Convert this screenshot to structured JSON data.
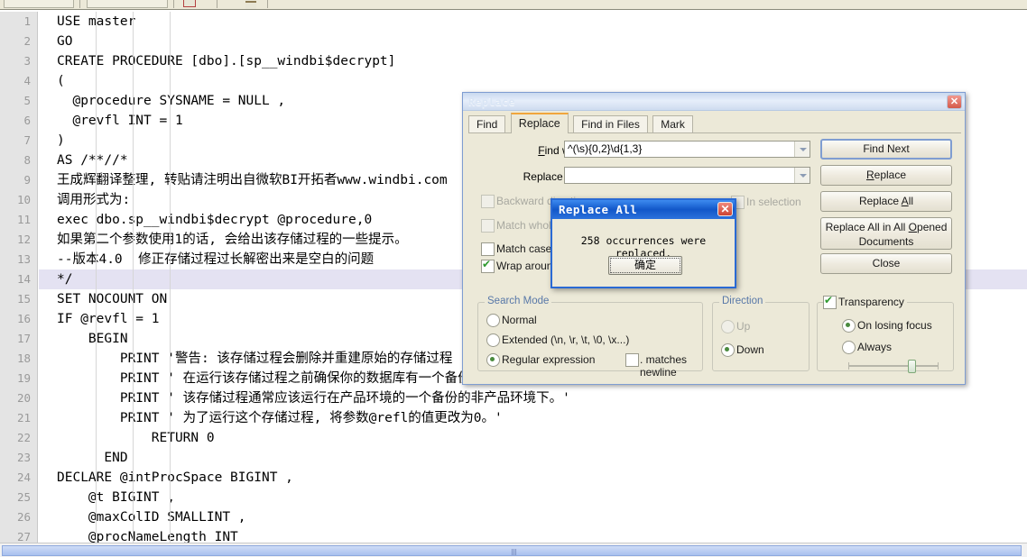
{
  "toolbar": {
    "name": "editor-toolbar"
  },
  "editor": {
    "current_line": 14,
    "lines": [
      {
        "n": "1",
        "text": "USE master"
      },
      {
        "n": "2",
        "text": "GO"
      },
      {
        "n": "3",
        "text": "CREATE PROCEDURE [dbo].[sp__windbi$decrypt]"
      },
      {
        "n": "4",
        "text": "("
      },
      {
        "n": "5",
        "text": "  @procedure SYSNAME = NULL ,"
      },
      {
        "n": "6",
        "text": "  @revfl INT = 1"
      },
      {
        "n": "7",
        "text": ")"
      },
      {
        "n": "8",
        "text": "AS /**//*"
      },
      {
        "n": "9",
        "text": "王成辉翻译整理, 转贴请注明出自微软BI开拓者www.windbi.com"
      },
      {
        "n": "10",
        "text": "调用形式为:"
      },
      {
        "n": "11",
        "text": "exec dbo.sp__windbi$decrypt @procedure,0"
      },
      {
        "n": "12",
        "text": "如果第二个参数使用1的话, 会给出该存储过程的一些提示。"
      },
      {
        "n": "13",
        "text": "--版本4.0  修正存储过程过长解密出来是空白的问题"
      },
      {
        "n": "14",
        "text": "*/"
      },
      {
        "n": "15",
        "text": "SET NOCOUNT ON"
      },
      {
        "n": "16",
        "text": "IF @revfl = 1"
      },
      {
        "n": "17",
        "text": "    BEGIN"
      },
      {
        "n": "18",
        "text": "        PRINT '警告: 该存储过程会删除并重建原始的存储过程"
      },
      {
        "n": "19",
        "text": "        PRINT ' 在运行该存储过程之前确保你的数据库有一个备份。'"
      },
      {
        "n": "20",
        "text": "        PRINT ' 该存储过程通常应该运行在产品环境的一个备份的非产品环境下。'"
      },
      {
        "n": "21",
        "text": "        PRINT ' 为了运行这个存储过程, 将参数@refl的值更改为0。'"
      },
      {
        "n": "22",
        "text": "            RETURN 0"
      },
      {
        "n": "23",
        "text": "      END"
      },
      {
        "n": "24",
        "text": "DECLARE @intProcSpace BIGINT ,"
      },
      {
        "n": "25",
        "text": "    @t BIGINT ,"
      },
      {
        "n": "26",
        "text": "    @maxColID SMALLINT ,"
      },
      {
        "n": "27",
        "text": "    @procNameLength INT"
      }
    ]
  },
  "replace_dialog": {
    "title": "Replace",
    "close_label": "✕",
    "tabs": [
      {
        "label": "Find",
        "active": false
      },
      {
        "label": "Replace",
        "active": true
      },
      {
        "label": "Find in Files",
        "active": false
      },
      {
        "label": "Mark",
        "active": false
      }
    ],
    "find_what_label": "Find what :",
    "find_what_value": "^(\\s){0,2}\\d{1,3}",
    "replace_with_label": "Replace with :",
    "replace_with_value": "",
    "checkboxes": {
      "backward_direction": "Backward direction",
      "match_whole_word": "Match whole word only",
      "match_case": "Match case",
      "wrap_around": "Wrap around",
      "in_selection": "In selection"
    },
    "search_mode": {
      "legend": "Search Mode",
      "normal": "Normal",
      "extended": "Extended (\\n, \\r, \\t, \\0, \\x...)",
      "regex": "Regular expression",
      "matches_newline": ". matches newline",
      "selected": "regex"
    },
    "direction": {
      "legend": "Direction",
      "up": "Up",
      "down": "Down",
      "selected": "down"
    },
    "transparency": {
      "label": "Transparency",
      "checked": true,
      "on_losing_focus": "On losing focus",
      "always": "Always",
      "selected": "on_losing_focus",
      "slider_percent": 72
    },
    "buttons": {
      "find_next": "Find Next",
      "replace": "Replace",
      "replace_all": "Replace All",
      "replace_all_opened": "Replace All in All Opened Documents",
      "close": "Close"
    }
  },
  "message_box": {
    "title": "Replace All",
    "close_label": "✕",
    "text": "258 occurrences were replaced.",
    "ok_label": "确定"
  },
  "scrollbar": {
    "name": "horizontal-scrollbar"
  },
  "colors": {
    "active_title": "#1257c9",
    "accent_tab": "#f0a63c",
    "current_line": "#e4e2f2",
    "gutter": "#e4e4e4"
  }
}
